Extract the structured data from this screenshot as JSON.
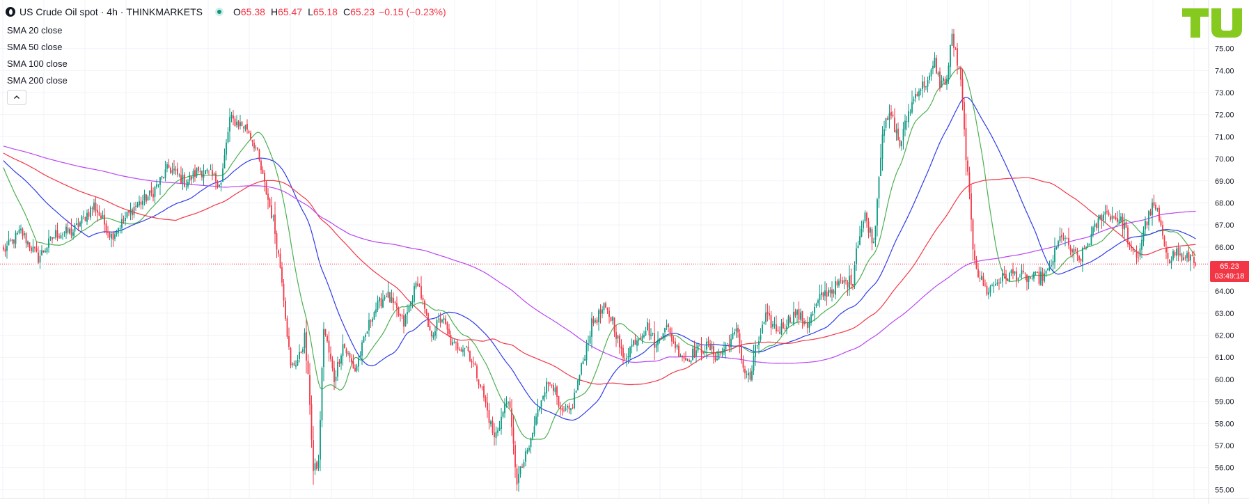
{
  "header": {
    "symbol": "US Crude Oil spot",
    "separator1": "·",
    "interval": "4h",
    "separator2": "·",
    "exchange": "THINKMARKETS",
    "ohlc": {
      "o_label": "O",
      "o_value": "65.38",
      "h_label": "H",
      "h_value": "65.47",
      "l_label": "L",
      "l_value": "65.18",
      "c_label": "C",
      "c_value": "65.23",
      "change": "−0.15 (−0.23%)"
    }
  },
  "legend": {
    "items": [
      "SMA 20 close",
      "SMA 50 close",
      "SMA 100 close",
      "SMA 200 close"
    ]
  },
  "price_label": {
    "price": "65.23",
    "countdown": "03:49:18"
  },
  "icons": {
    "symbol_logo": "oil-drop-icon",
    "status": "market-open-dot-icon",
    "collapse": "chevron-up-icon",
    "brand": "tradingview-logo-icon"
  },
  "colors": {
    "up": "#089981",
    "down": "#f23645",
    "sma20": "#4caf50",
    "sma50": "#f23645",
    "sma100": "#2d3be8",
    "sma200": "#b845f5",
    "grid": "#f0f3fa",
    "brand": "#86c91f"
  },
  "chart_data": {
    "type": "candlestick",
    "title": "US Crude Oil spot · 4h · THINKMARKETS",
    "ylim": [
      54.6,
      77.2
    ],
    "y_ticks": [
      55,
      56,
      57,
      58,
      59,
      60,
      61,
      62,
      63,
      64,
      65,
      66,
      67,
      68,
      69,
      70,
      71,
      72,
      73,
      74,
      75
    ],
    "last_price": 65.23,
    "grid": true,
    "anchors": [
      [
        0,
        65.8
      ],
      [
        10,
        66.7
      ],
      [
        20,
        65.5
      ],
      [
        30,
        66.6
      ],
      [
        40,
        66.7
      ],
      [
        52,
        67.9
      ],
      [
        62,
        66.5
      ],
      [
        75,
        67.8
      ],
      [
        85,
        68.4
      ],
      [
        95,
        69.6
      ],
      [
        105,
        68.9
      ],
      [
        112,
        69.5
      ],
      [
        118,
        69.3
      ],
      [
        125,
        68.9
      ],
      [
        130,
        71.8
      ],
      [
        140,
        71.4
      ],
      [
        145,
        70.5
      ],
      [
        150,
        68.8
      ],
      [
        155,
        67.2
      ],
      [
        160,
        64.6
      ],
      [
        165,
        60.5
      ],
      [
        170,
        61.0
      ],
      [
        173,
        61.9
      ],
      [
        176,
        59.0
      ],
      [
        178,
        55.8
      ],
      [
        181,
        56.2
      ],
      [
        184,
        62.4
      ],
      [
        190,
        60.0
      ],
      [
        195,
        61.6
      ],
      [
        202,
        60.4
      ],
      [
        212,
        63.0
      ],
      [
        220,
        63.9
      ],
      [
        230,
        62.5
      ],
      [
        238,
        64.5
      ],
      [
        245,
        62.0
      ],
      [
        252,
        62.8
      ],
      [
        258,
        61.5
      ],
      [
        266,
        61.5
      ],
      [
        274,
        59.8
      ],
      [
        282,
        57.3
      ],
      [
        290,
        59.2
      ],
      [
        295,
        55.4
      ],
      [
        302,
        56.9
      ],
      [
        310,
        59.5
      ],
      [
        315,
        60.0
      ],
      [
        320,
        58.4
      ],
      [
        326,
        58.6
      ],
      [
        332,
        60.5
      ],
      [
        338,
        62.5
      ],
      [
        345,
        63.2
      ],
      [
        350,
        62.7
      ],
      [
        356,
        60.9
      ],
      [
        363,
        61.8
      ],
      [
        370,
        62.4
      ],
      [
        375,
        61.5
      ],
      [
        380,
        62.5
      ],
      [
        387,
        61.4
      ],
      [
        392,
        60.9
      ],
      [
        398,
        61.3
      ],
      [
        405,
        61.5
      ],
      [
        410,
        61.0
      ],
      [
        418,
        61.8
      ],
      [
        422,
        62.2
      ],
      [
        425,
        60.5
      ],
      [
        429,
        60.0
      ],
      [
        432,
        61.3
      ],
      [
        438,
        62.8
      ],
      [
        445,
        62.2
      ],
      [
        455,
        63.0
      ],
      [
        462,
        62.5
      ],
      [
        470,
        63.8
      ],
      [
        480,
        64.3
      ],
      [
        488,
        64.5
      ],
      [
        490,
        66.0
      ],
      [
        495,
        67.4
      ],
      [
        500,
        66.2
      ],
      [
        505,
        71.3
      ],
      [
        510,
        72.0
      ],
      [
        515,
        70.6
      ],
      [
        520,
        72.1
      ],
      [
        525,
        73.1
      ],
      [
        532,
        73.6
      ],
      [
        535,
        74.4
      ],
      [
        538,
        73.4
      ],
      [
        542,
        73.6
      ],
      [
        545,
        75.6
      ],
      [
        550,
        73.5
      ],
      [
        552,
        71.2
      ],
      [
        555,
        68.2
      ],
      [
        557,
        66.0
      ],
      [
        560,
        64.8
      ],
      [
        565,
        64.0
      ],
      [
        572,
        64.5
      ],
      [
        580,
        64.8
      ],
      [
        588,
        64.6
      ],
      [
        595,
        64.6
      ],
      [
        600,
        64.8
      ],
      [
        608,
        66.6
      ],
      [
        612,
        66.0
      ],
      [
        618,
        65.4
      ],
      [
        622,
        66.0
      ],
      [
        628,
        67.0
      ],
      [
        632,
        67.6
      ],
      [
        640,
        67.3
      ],
      [
        644,
        67.0
      ],
      [
        648,
        65.7
      ],
      [
        652,
        65.6
      ],
      [
        655,
        66.8
      ],
      [
        660,
        67.8
      ],
      [
        663,
        67.6
      ],
      [
        666,
        66.3
      ],
      [
        670,
        65.5
      ],
      [
        674,
        65.8
      ],
      [
        678,
        65.4
      ],
      [
        683,
        65.6
      ],
      [
        685,
        65.23
      ]
    ]
  }
}
